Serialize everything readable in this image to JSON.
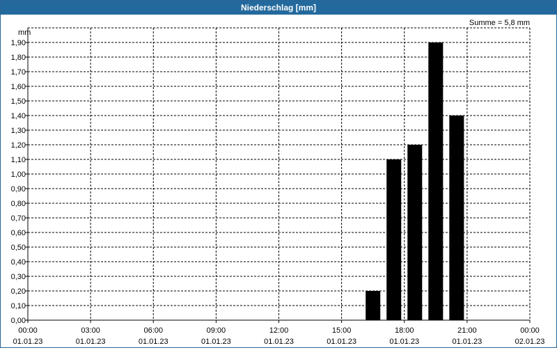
{
  "window": {
    "title": "Niederschlag [mm]"
  },
  "chart_data": {
    "type": "bar",
    "title": "Niederschlag [mm]",
    "ylabel": "mm",
    "summary": "Summe = 5,8 mm",
    "ylim": [
      0,
      2.0
    ],
    "yticks": [
      "0,00",
      "0,10",
      "0,20",
      "0,30",
      "0,40",
      "0,50",
      "0,60",
      "0,70",
      "0,80",
      "0,90",
      "1,00",
      "1,10",
      "1,20",
      "1,30",
      "1,40",
      "1,50",
      "1,60",
      "1,70",
      "1,80",
      "1,90"
    ],
    "xticks": [
      {
        "time": "00:00",
        "date": "01.01.23"
      },
      {
        "time": "03:00",
        "date": "01.01.23"
      },
      {
        "time": "06:00",
        "date": "01.01.23"
      },
      {
        "time": "09:00",
        "date": "01.01.23"
      },
      {
        "time": "12:00",
        "date": "01.01.23"
      },
      {
        "time": "15:00",
        "date": "01.01.23"
      },
      {
        "time": "18:00",
        "date": "01.01.23"
      },
      {
        "time": "21:00",
        "date": "01.01.23"
      },
      {
        "time": "00:00",
        "date": "02.01.23"
      }
    ],
    "bars": [
      {
        "time": "16:00",
        "value": 0.2
      },
      {
        "time": "17:00",
        "value": 1.1
      },
      {
        "time": "18:00",
        "value": 1.2
      },
      {
        "time": "19:00",
        "value": 1.9
      },
      {
        "time": "20:00",
        "value": 1.4
      }
    ],
    "grid": true,
    "colors": {
      "bar": "#000000",
      "title_bar": "#24699d",
      "title_text": "#ffffff"
    }
  }
}
